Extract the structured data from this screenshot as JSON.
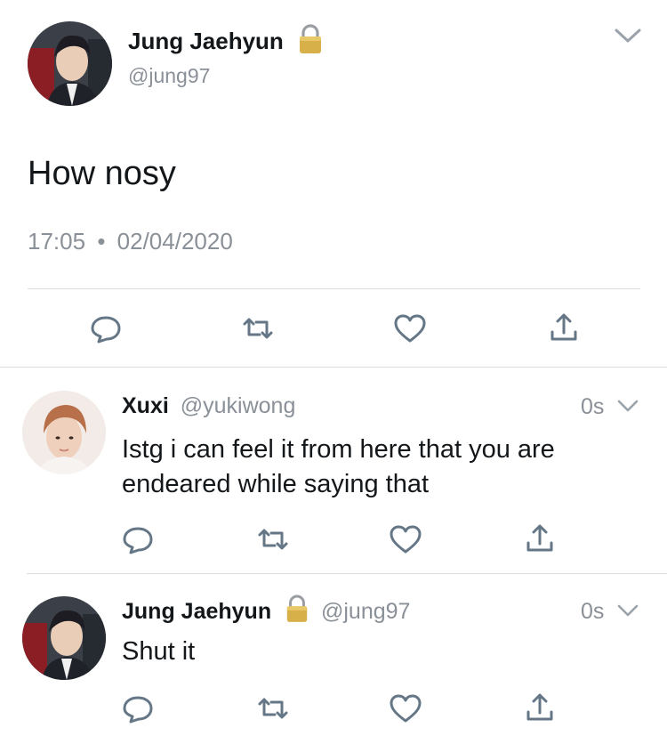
{
  "main_tweet": {
    "display_name": "Jung Jaehyun",
    "handle": "@jung97",
    "text": "How nosy",
    "time": "17:05",
    "separator": "•",
    "date": "02/04/2020"
  },
  "replies": [
    {
      "display_name": "Xuxi",
      "handle": "@yukiwong",
      "time_ago": "0s",
      "text": "Istg i can feel it from here that you are endeared while saying that"
    },
    {
      "display_name": "Jung Jaehyun",
      "handle": "@jung97",
      "time_ago": "0s",
      "text": "Shut it"
    }
  ],
  "icons": {
    "reply": "reply-icon",
    "retweet": "retweet-icon",
    "like": "heart-icon",
    "share": "share-icon",
    "lock": "lock-icon",
    "chevron": "chevron-down-icon"
  },
  "colors": {
    "text": "#14171a",
    "muted": "#8a9097",
    "icon": "#657786",
    "divider": "#d9dde1",
    "lock_gold": "#d8b04a"
  }
}
